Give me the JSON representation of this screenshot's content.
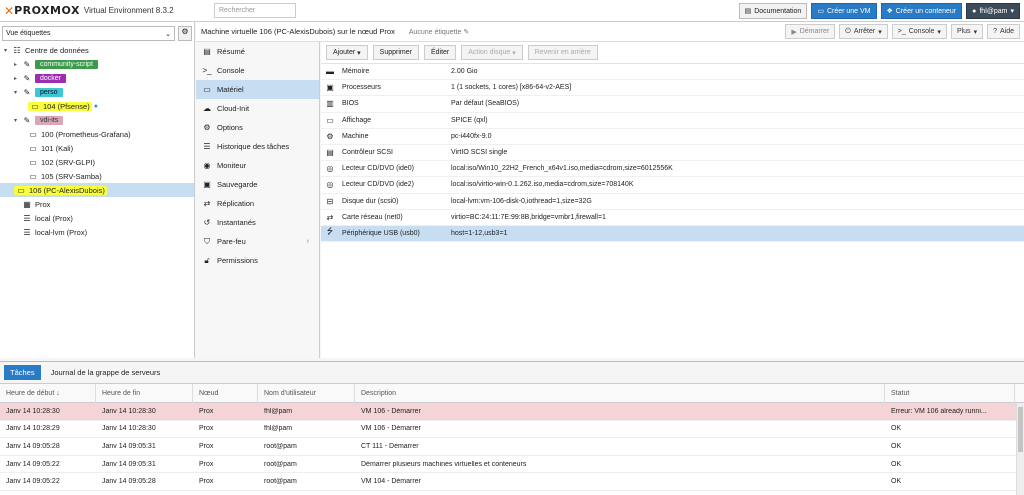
{
  "header": {
    "logo_text": "PROXMOX",
    "version": "Virtual Environment 8.3.2",
    "search_placeholder": "Rechercher",
    "buttons": {
      "documentation": "Documentation",
      "create_vm": "Créer une VM",
      "create_ct": "Créer un conteneur",
      "user": "fhl@pam"
    }
  },
  "view": {
    "selected": "Vue étiquettes"
  },
  "tree": {
    "root": "Centre de données",
    "tag_community": "community-script",
    "tag_docker": "docker",
    "tag_perso": "perso",
    "vm104": "104 (Pfsense)",
    "tag_vdi": "vdi-its",
    "vm100": "100 (Prometheus-Grafana)",
    "vm101": "101 (Kali)",
    "vm102": "102 (SRV-GLPI)",
    "vm105": "105 (SRV-Samba)",
    "vm106": "106 (PC-AlexisDubois)",
    "node": "Prox",
    "storage_local": "local (Prox)",
    "storage_lvm": "local-lvm (Prox)"
  },
  "vm_header": {
    "title": "Machine virtuelle 106 (PC-AlexisDubois) sur le nœud Prox",
    "tags": "Aucune étiquette",
    "start": "Démarrer",
    "stop": "Arrêter",
    "console": "Console",
    "more": "Plus",
    "help": "Aide"
  },
  "nav": {
    "items": [
      {
        "label": "Résumé"
      },
      {
        "label": "Console"
      },
      {
        "label": "Matériel"
      },
      {
        "label": "Cloud-Init"
      },
      {
        "label": "Options"
      },
      {
        "label": "Historique des tâches"
      },
      {
        "label": "Moniteur"
      },
      {
        "label": "Sauvegarde"
      },
      {
        "label": "Réplication"
      },
      {
        "label": "Instantanés"
      },
      {
        "label": "Pare-feu"
      },
      {
        "label": "Permissions"
      }
    ]
  },
  "toolbar": {
    "add": "Ajouter",
    "remove": "Supprimer",
    "edit": "Éditer",
    "disk_action": "Action disque",
    "revert": "Revenir en arrière"
  },
  "hardware": {
    "rows": [
      {
        "name": "Mémoire",
        "value": "2.00 Gio"
      },
      {
        "name": "Processeurs",
        "value": "1 (1 sockets, 1 cores) [x86-64-v2-AES]"
      },
      {
        "name": "BIOS",
        "value": "Par défaut (SeaBIOS)"
      },
      {
        "name": "Affichage",
        "value": "SPICE (qxl)"
      },
      {
        "name": "Machine",
        "value": "pc-i440fx-9.0"
      },
      {
        "name": "Contrôleur SCSI",
        "value": "VirtIO SCSI single"
      },
      {
        "name": "Lecteur CD/DVD (ide0)",
        "value": "local:iso/Win10_22H2_French_x64v1.iso,media=cdrom,size=6012556K"
      },
      {
        "name": "Lecteur CD/DVD (ide2)",
        "value": "local:iso/virtio-win-0.1.262.iso,media=cdrom,size=708140K"
      },
      {
        "name": "Disque dur (scsi0)",
        "value": "local-lvm:vm-106-disk-0,iothread=1,size=32G"
      },
      {
        "name": "Carte réseau (net0)",
        "value": "virtio=BC:24:11:7E:99:8B,bridge=vmbr1,firewall=1"
      },
      {
        "name": "Périphérique USB (usb0)",
        "value": "host=1-12,usb3=1"
      }
    ]
  },
  "tasks": {
    "tab_tasks": "Tâches",
    "tab_cluster": "Journal de la grappe de serveurs",
    "columns": [
      "Heure de début ↓",
      "Heure de fin",
      "Nœud",
      "Nom d'utilisateur",
      "Description",
      "Statut"
    ],
    "rows": [
      [
        "Janv 14 10:28:30",
        "Janv 14 10:28:30",
        "Prox",
        "fhl@pam",
        "VM 106 - Démarrer",
        "Erreur: VM 106 already runni..."
      ],
      [
        "Janv 14 10:28:29",
        "Janv 14 10:28:30",
        "Prox",
        "fhl@pam",
        "VM 106 - Démarrer",
        "OK"
      ],
      [
        "Janv 14 09:05:28",
        "Janv 14 09:05:31",
        "Prox",
        "root@pam",
        "CT 111 - Démarrer",
        "OK"
      ],
      [
        "Janv 14 09:05:22",
        "Janv 14 09:05:31",
        "Prox",
        "root@pam",
        "Démarrer plusieurs machines virtuelles et conteneurs",
        "OK"
      ],
      [
        "Janv 14 09:05:22",
        "Janv 14 09:05:28",
        "Prox",
        "root@pam",
        "VM 104 - Démarrer",
        "OK"
      ]
    ]
  }
}
